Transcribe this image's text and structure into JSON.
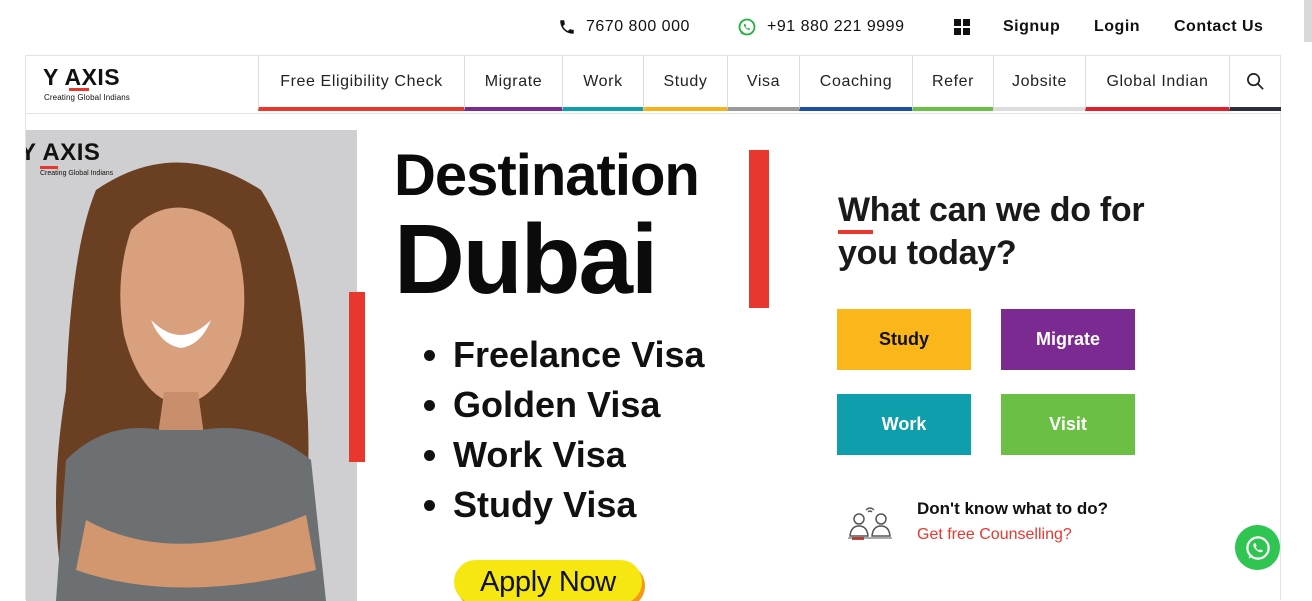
{
  "topbar": {
    "phone": "7670 800 000",
    "whatsapp": "+91 880 221 9999",
    "signup": "Signup",
    "login": "Login",
    "contact": "Contact Us"
  },
  "logo": {
    "main": "Y AXIS",
    "tagline": "Creating Global Indians"
  },
  "nav": {
    "items": [
      {
        "label": "Free Eligibility Check",
        "color": "#e8372c"
      },
      {
        "label": "Migrate",
        "color": "#7a2a90"
      },
      {
        "label": "Work",
        "color": "#0f9eac"
      },
      {
        "label": "Study",
        "color": "#f6b21b"
      },
      {
        "label": "Visa",
        "color": "#9a9a9a"
      },
      {
        "label": "Coaching",
        "color": "#1e4ea1"
      },
      {
        "label": "Refer",
        "color": "#6cbf45"
      },
      {
        "label": "Jobsite",
        "color": "#dcdcdc"
      },
      {
        "label": "Global Indian",
        "color": "#e01f2d"
      }
    ],
    "search_color": "#2b2f3a"
  },
  "banner": {
    "logo": "Y AXIS",
    "logo_tagline": "Creating Global Indians",
    "heading1": "Destination",
    "heading2": "Dubai",
    "list": [
      "Freelance Visa",
      "Golden Visa",
      "Work Visa",
      "Study Visa"
    ],
    "cta": "Apply Now"
  },
  "panel": {
    "title_line1": "What can we do for",
    "title_line2": "you today?",
    "buttons": [
      {
        "label": "Study",
        "color": "#fbb71a",
        "text_color": "#111111"
      },
      {
        "label": "Migrate",
        "color": "#7a2a90",
        "text_color": "#ffffff"
      },
      {
        "label": "Work",
        "color": "#0f9eac",
        "text_color": "#ffffff"
      },
      {
        "label": "Visit",
        "color": "#6cbf45",
        "text_color": "#ffffff"
      }
    ],
    "counsel_question": "Don't know what to do?",
    "counsel_link": "Get free Counselling?"
  }
}
